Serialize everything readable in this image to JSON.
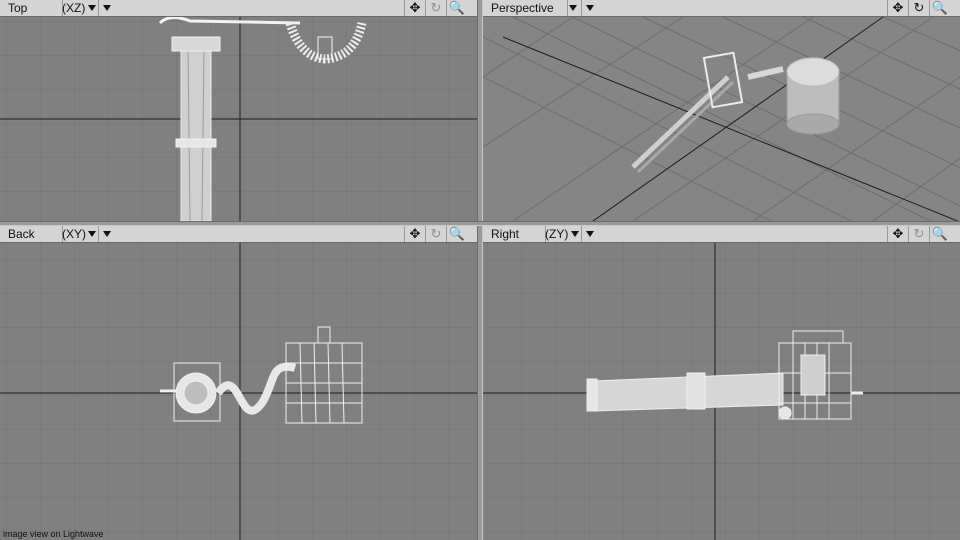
{
  "viewports": [
    {
      "view": "Top",
      "axes": "(XZ)"
    },
    {
      "view": "Perspective",
      "axes": ""
    },
    {
      "view": "Back",
      "axes": "(XY)"
    },
    {
      "view": "Right",
      "axes": "(ZY)"
    }
  ],
  "controls": {
    "move": "✥",
    "rotate": "↻",
    "zoom": "🔍"
  },
  "caption": "image view on Lightwave",
  "colors": {
    "viewport_bg": "#808080",
    "grid": "#747474",
    "axis": "#1c1c1c",
    "wire": "#f2f2f2",
    "header": "#d4d4d4"
  }
}
